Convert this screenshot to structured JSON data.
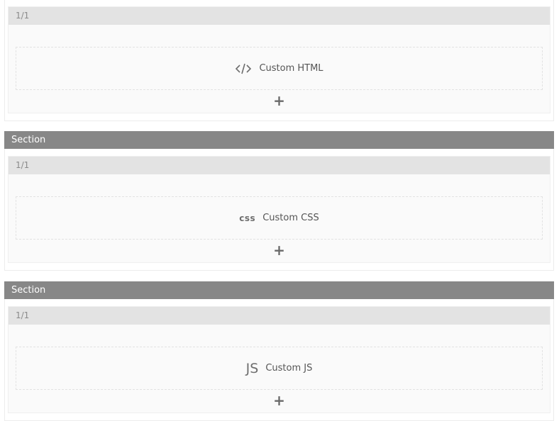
{
  "sections": [
    {
      "header": null,
      "column_label": "1/1",
      "element": {
        "icon": "code-brackets-icon",
        "icon_text": "",
        "label": "Custom HTML"
      },
      "add_symbol": "+"
    },
    {
      "header": "Section",
      "column_label": "1/1",
      "element": {
        "icon": "css-icon",
        "icon_text": "css",
        "label": "Custom CSS"
      },
      "add_symbol": "+"
    },
    {
      "header": "Section",
      "column_label": "1/1",
      "element": {
        "icon": "js-icon",
        "icon_text": "JS",
        "label": "Custom JS"
      },
      "add_symbol": "+"
    }
  ],
  "colors": {
    "section_header_bg": "#878787",
    "row_header_bg": "#e3e3e3",
    "row_bg": "#fafafa"
  }
}
